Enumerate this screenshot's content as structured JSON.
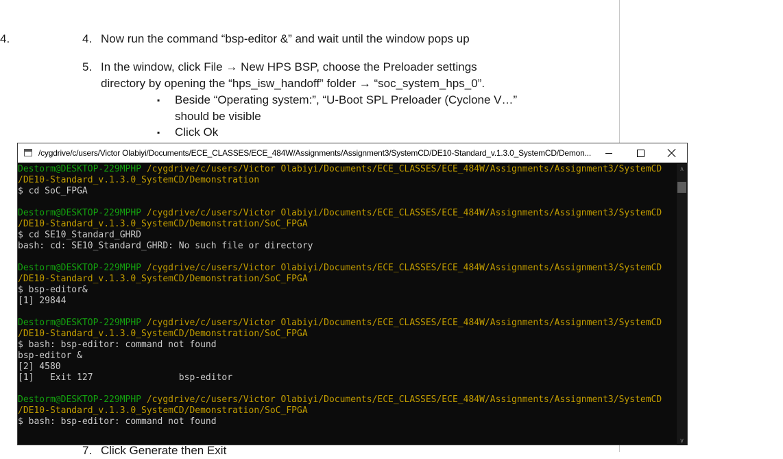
{
  "document": {
    "items": [
      {
        "number": "4.",
        "line1": "Now run the command “bsp-editor &” and wait until the window pops up"
      },
      {
        "number": "5.",
        "line1": "In the window, click File → New HPS BSP, choose the Preloader settings",
        "line2": "directory by opening the “hps_isw_handoff” folder → “soc_system_hps_0”."
      },
      {
        "number": "7.",
        "line1": "Click Generate then Exit"
      }
    ],
    "bullets": [
      {
        "mark": "▪",
        "line1": "Beside “Operating system:”, “U-Boot SPL Preloader (Cyclone V…”",
        "line2": "should be visible"
      },
      {
        "mark": "▪",
        "line1": "Click Ok"
      }
    ]
  },
  "terminal": {
    "title": "/cygdrive/c/users/Victor Olabiyi/Documents/ECE_CLASSES/ECE_484W/Assignments/Assignment3/SystemCD/DE10-Standard_v.1.3.0_SystemCD/Demon...",
    "prompt_user": "Destorm@DESKTOP-229MPHP",
    "path_a": "/cygdrive/c/users/Victor Olabiyi/Documents/ECE_CLASSES/ECE_484W/Assignments/Assignment3/SystemCD",
    "path_b1": "/DE10-Standard_v.1.3.0_SystemCD/Demonstration",
    "path_b2": "/DE10-Standard_v.1.3.0_SystemCD/Demonstration/SoC_FPGA",
    "lines": {
      "cmd1": "$ cd SoC_FPGA",
      "cmd2": "$ cd SE10_Standard_GHRD",
      "out2": "bash: cd: SE10_Standard_GHRD: No such file or directory",
      "cmd3": "$ bsp-editor&",
      "out3": "[1] 29844",
      "out4a": "$ bash: bsp-editor: command not found",
      "out4b": "bsp-editor &",
      "out4c": "[2] 4580",
      "out4d": "[1]   Exit 127                bsp-editor",
      "out5": "$ bash: bsp-editor: command not found"
    },
    "icons": {
      "app": "terminal-icon",
      "minimize": "minimize-icon",
      "maximize": "maximize-icon",
      "close": "close-icon",
      "scroll_up": "chevron-up-icon",
      "scroll_down": "chevron-down-icon"
    },
    "scroll_up_glyph": "∧",
    "scroll_down_glyph": "∨",
    "colors": {
      "background": "#0c0c0c",
      "prompt_user": "#13a10e",
      "prompt_path": "#c19c00",
      "text": "#cccccc"
    }
  }
}
